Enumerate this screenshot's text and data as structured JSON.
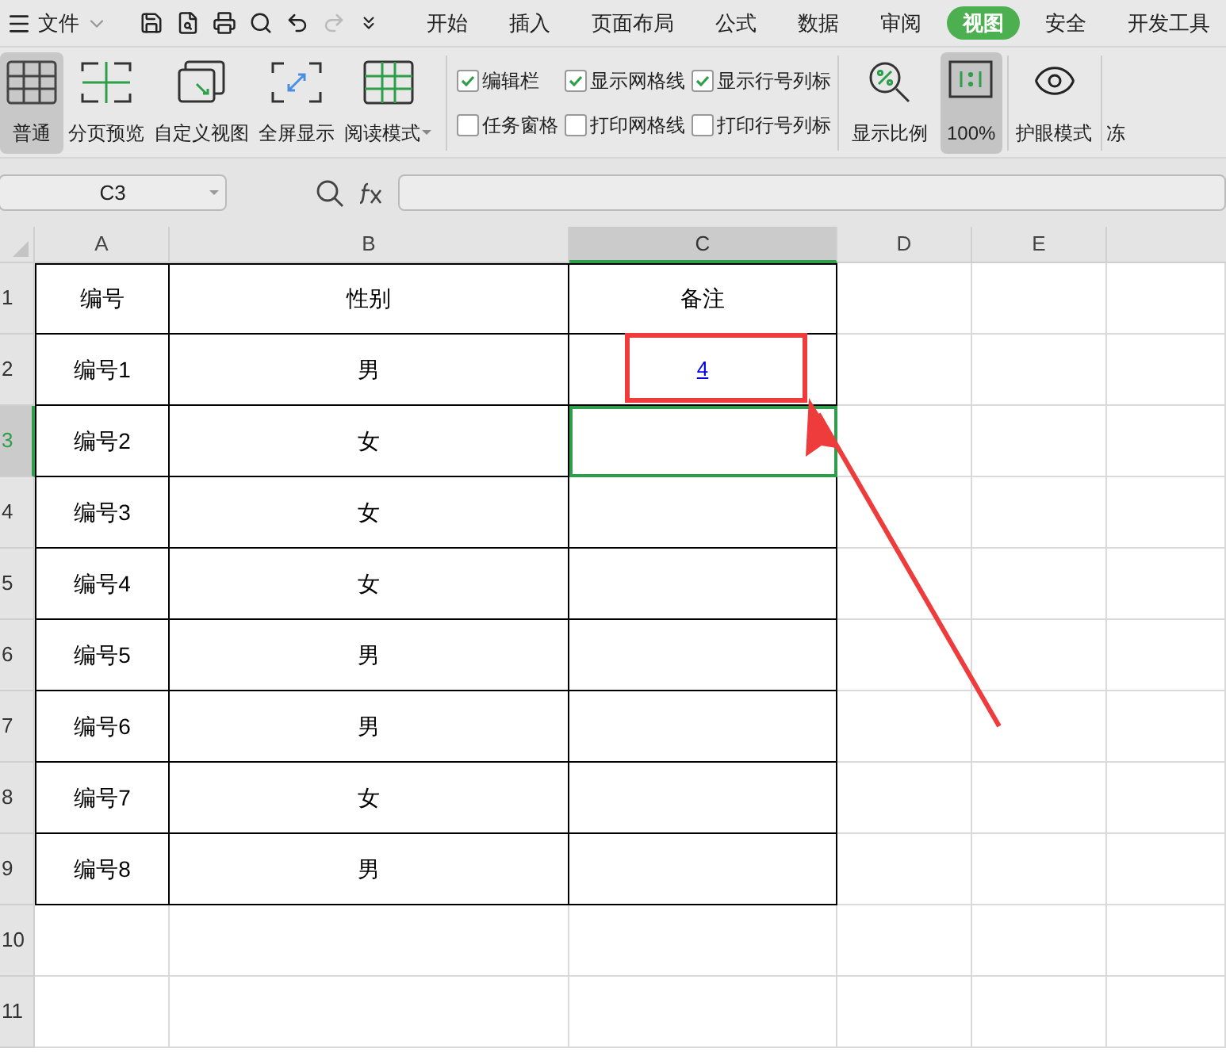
{
  "menu": {
    "file_label": "文件"
  },
  "tabs": [
    {
      "label": "开始",
      "selected": false
    },
    {
      "label": "插入",
      "selected": false
    },
    {
      "label": "页面布局",
      "selected": false
    },
    {
      "label": "公式",
      "selected": false
    },
    {
      "label": "数据",
      "selected": false
    },
    {
      "label": "审阅",
      "selected": false
    },
    {
      "label": "视图",
      "selected": true
    },
    {
      "label": "安全",
      "selected": false
    },
    {
      "label": "开发工具",
      "selected": false
    }
  ],
  "ribbon": {
    "views": [
      {
        "kind": "normal",
        "label": "普通",
        "selected": true
      },
      {
        "kind": "pagebreak",
        "label": "分页预览",
        "selected": false
      },
      {
        "kind": "custom",
        "label": "自定义视图",
        "selected": false
      },
      {
        "kind": "fullscreen",
        "label": "全屏显示",
        "selected": false
      },
      {
        "kind": "reading",
        "label": "阅读模式",
        "selected": false
      }
    ],
    "checkbox_columns": [
      [
        {
          "label": "编辑栏",
          "checked": true
        },
        {
          "label": "任务窗格",
          "checked": false
        }
      ],
      [
        {
          "label": "显示网格线",
          "checked": true
        },
        {
          "label": "打印网格线",
          "checked": false
        }
      ],
      [
        {
          "label": "显示行号列标",
          "checked": true
        },
        {
          "label": "打印行号列标",
          "checked": false
        }
      ]
    ],
    "zoom": [
      {
        "kind": "ratio",
        "label": "显示比例",
        "selected": false
      },
      {
        "kind": "actual",
        "label": "100%",
        "selected": true
      }
    ],
    "eye_label": "护眼模式",
    "freeze_label": "冻"
  },
  "name_box": "C3",
  "columns": [
    {
      "label": "A",
      "selected": false
    },
    {
      "label": "B",
      "selected": false
    },
    {
      "label": "C",
      "selected": true
    },
    {
      "label": "D",
      "selected": false
    },
    {
      "label": "E",
      "selected": false
    }
  ],
  "rows": [
    {
      "header": "1",
      "selected": false,
      "cells": [
        {
          "kind": "text",
          "text": "编号"
        },
        {
          "kind": "text",
          "text": "性别"
        },
        {
          "kind": "text",
          "text": "备注"
        }
      ]
    },
    {
      "header": "2",
      "selected": false,
      "cells": [
        {
          "kind": "text",
          "text": "编号1"
        },
        {
          "kind": "text",
          "text": "男"
        },
        {
          "kind": "link",
          "text": "4"
        }
      ]
    },
    {
      "header": "3",
      "selected": true,
      "cells": [
        {
          "kind": "text",
          "text": "编号2"
        },
        {
          "kind": "text",
          "text": "女"
        },
        {
          "kind": "empty",
          "selected": true
        }
      ]
    },
    {
      "header": "4",
      "selected": false,
      "cells": [
        {
          "kind": "text",
          "text": "编号3"
        },
        {
          "kind": "text",
          "text": "女"
        }
      ]
    },
    {
      "header": "5",
      "selected": false,
      "cells": [
        {
          "kind": "text",
          "text": "编号4"
        },
        {
          "kind": "text",
          "text": "女"
        }
      ]
    },
    {
      "header": "6",
      "selected": false,
      "cells": [
        {
          "kind": "text",
          "text": "编号5"
        },
        {
          "kind": "text",
          "text": "男"
        }
      ]
    },
    {
      "header": "7",
      "selected": false,
      "cells": [
        {
          "kind": "text",
          "text": "编号6"
        },
        {
          "kind": "text",
          "text": "男"
        }
      ]
    },
    {
      "header": "8",
      "selected": false,
      "cells": [
        {
          "kind": "text",
          "text": "编号7"
        },
        {
          "kind": "text",
          "text": "女"
        }
      ]
    },
    {
      "header": "9",
      "selected": false,
      "cells": [
        {
          "kind": "text",
          "text": "编号8"
        },
        {
          "kind": "text",
          "text": "男"
        }
      ]
    },
    {
      "header": "10",
      "selected": false,
      "cells": []
    },
    {
      "header": "11",
      "selected": false,
      "cells": []
    }
  ]
}
